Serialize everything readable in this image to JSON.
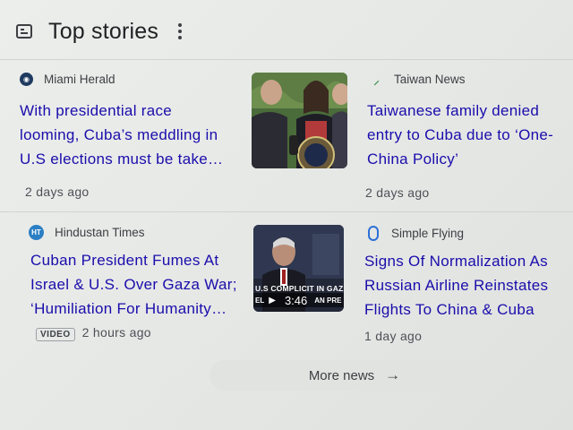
{
  "header": {
    "title": "Top stories"
  },
  "stories": [
    {
      "source": "Miami Herald",
      "headline": [
        "With presidential race",
        "looming, Cuba’s meddling in",
        "U.S elections must be take…"
      ],
      "time": "2 days ago"
    },
    {
      "source": "Taiwan News",
      "headline": [
        "Taiwanese family denied",
        "entry to Cuba due to ‘One-",
        "China Policy’"
      ],
      "time": "2 days ago"
    },
    {
      "source": "Hindustan Times",
      "headline": [
        "Cuban President Fumes At",
        "Israel & U.S. Over Gaza War;",
        "‘Humiliation For Humanity…"
      ],
      "time": "2 hours ago",
      "badge": "VIDEO",
      "video_duration": "3:46",
      "video_caption": [
        "U.S COMPLICIT IN GAZA",
        "EL",
        "AN PRE"
      ]
    },
    {
      "source": "Simple Flying",
      "headline": [
        "Signs Of Normalization As",
        "Russian Airline Reinstates",
        "Flights To China & Cuba"
      ],
      "time": "1 day ago"
    }
  ],
  "more_button": {
    "label": "More news",
    "arrow": "→"
  },
  "colors": {
    "headline": "#1a0dab",
    "background": "#e8eae8",
    "button": "#e0e3e0"
  },
  "icons": [
    "news-icon",
    "more-vert-icon",
    "miami-herald-logo-icon",
    "taiwan-news-logo-icon",
    "hindustan-times-logo-icon",
    "simple-flying-logo-icon",
    "play-icon",
    "arrow-right-icon"
  ]
}
